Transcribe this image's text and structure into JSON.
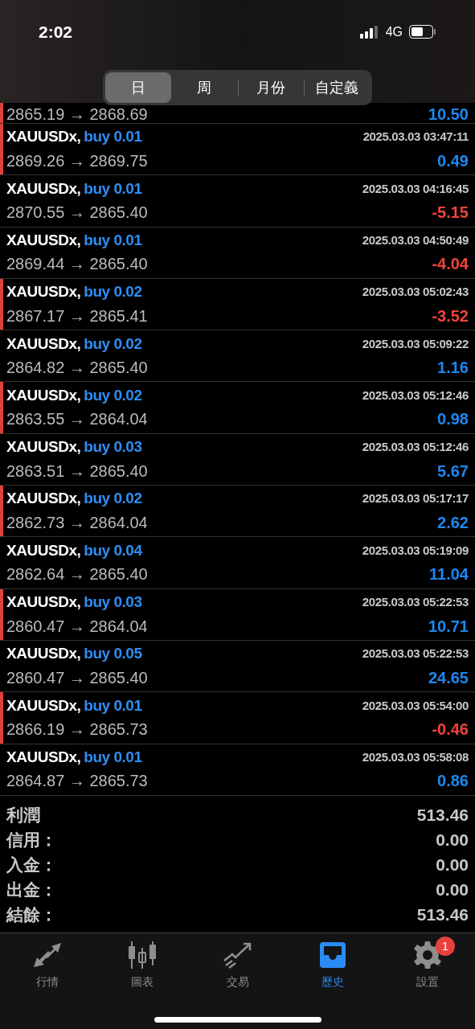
{
  "status_bar": {
    "time": "2:02",
    "network": "4G"
  },
  "period_tabs": [
    {
      "label": "日",
      "selected": true
    },
    {
      "label": "周",
      "selected": false
    },
    {
      "label": "月份",
      "selected": false
    },
    {
      "label": "自定義",
      "selected": false
    }
  ],
  "partial_deal": {
    "prices": "2865.19 → 2868.69",
    "profit": "10.50",
    "color": "#1e88f0",
    "flagged": true
  },
  "deals": [
    {
      "symbol": "XAUUSDx,",
      "order": "buy 0.01",
      "time": "2025.03.03 03:47:11",
      "prices": "2869.26 → 2869.75",
      "profit": "0.49",
      "color": "#1e88f0",
      "flagged": true
    },
    {
      "symbol": "XAUUSDx,",
      "order": "buy 0.01",
      "time": "2025.03.03 04:16:45",
      "prices": "2870.55 → 2865.40",
      "profit": "-5.15",
      "color": "#f0443a",
      "flagged": false
    },
    {
      "symbol": "XAUUSDx,",
      "order": "buy 0.01",
      "time": "2025.03.03 04:50:49",
      "prices": "2869.44 → 2865.40",
      "profit": "-4.04",
      "color": "#f0443a",
      "flagged": false
    },
    {
      "symbol": "XAUUSDx,",
      "order": "buy 0.02",
      "time": "2025.03.03 05:02:43",
      "prices": "2867.17 → 2865.41",
      "profit": "-3.52",
      "color": "#f0443a",
      "flagged": true
    },
    {
      "symbol": "XAUUSDx,",
      "order": "buy 0.02",
      "time": "2025.03.03 05:09:22",
      "prices": "2864.82 → 2865.40",
      "profit": "1.16",
      "color": "#1e88f0",
      "flagged": false
    },
    {
      "symbol": "XAUUSDx,",
      "order": "buy 0.02",
      "time": "2025.03.03 05:12:46",
      "prices": "2863.55 → 2864.04",
      "profit": "0.98",
      "color": "#1e88f0",
      "flagged": true
    },
    {
      "symbol": "XAUUSDx,",
      "order": "buy 0.03",
      "time": "2025.03.03 05:12:46",
      "prices": "2863.51 → 2865.40",
      "profit": "5.67",
      "color": "#1e88f0",
      "flagged": false
    },
    {
      "symbol": "XAUUSDx,",
      "order": "buy 0.02",
      "time": "2025.03.03 05:17:17",
      "prices": "2862.73 → 2864.04",
      "profit": "2.62",
      "color": "#1e88f0",
      "flagged": true
    },
    {
      "symbol": "XAUUSDx,",
      "order": "buy 0.04",
      "time": "2025.03.03 05:19:09",
      "prices": "2862.64 → 2865.40",
      "profit": "11.04",
      "color": "#1e88f0",
      "flagged": false
    },
    {
      "symbol": "XAUUSDx,",
      "order": "buy 0.03",
      "time": "2025.03.03 05:22:53",
      "prices": "2860.47 → 2864.04",
      "profit": "10.71",
      "color": "#1e88f0",
      "flagged": true
    },
    {
      "symbol": "XAUUSDx,",
      "order": "buy 0.05",
      "time": "2025.03.03 05:22:53",
      "prices": "2860.47 → 2865.40",
      "profit": "24.65",
      "color": "#1e88f0",
      "flagged": false
    },
    {
      "symbol": "XAUUSDx,",
      "order": "buy 0.01",
      "time": "2025.03.03 05:54:00",
      "prices": "2866.19 → 2865.73",
      "profit": "-0.46",
      "color": "#f0443a",
      "flagged": true
    },
    {
      "symbol": "XAUUSDx,",
      "order": "buy 0.01",
      "time": "2025.03.03 05:58:08",
      "prices": "2864.87 → 2865.73",
      "profit": "0.86",
      "color": "#1e88f0",
      "flagged": false
    }
  ],
  "summary": [
    {
      "label": "利潤",
      "value": "513.46"
    },
    {
      "label": "信用：",
      "value": "0.00"
    },
    {
      "label": "入金：",
      "value": "0.00"
    },
    {
      "label": "出金：",
      "value": "0.00"
    },
    {
      "label": "結餘：",
      "value": "513.46"
    }
  ],
  "bottom_nav": [
    {
      "kind": "quotes",
      "label": "行情",
      "selected": false
    },
    {
      "kind": "chart",
      "label": "圖表",
      "selected": false
    },
    {
      "kind": "trade",
      "label": "交易",
      "selected": false
    },
    {
      "kind": "history",
      "label": "歷史",
      "selected": true
    },
    {
      "kind": "settings",
      "label": "設置",
      "selected": false,
      "badge": "1"
    }
  ]
}
